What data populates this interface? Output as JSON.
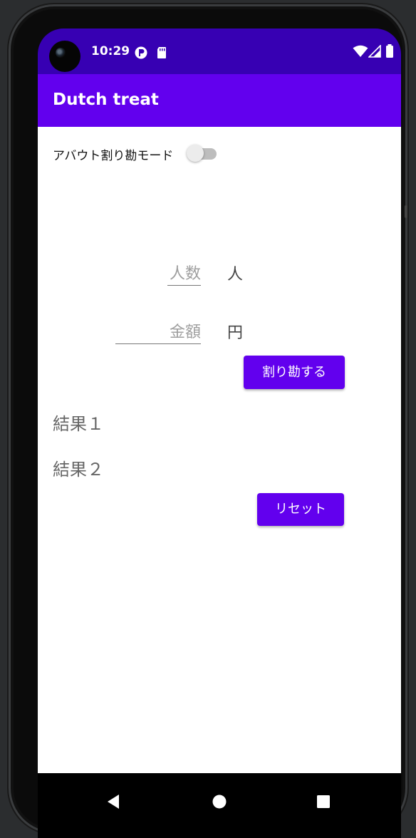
{
  "status_bar": {
    "time": "10:29",
    "icons": [
      "app-notification-icon",
      "sd-card-icon",
      "wifi-icon",
      "cell-signal-icon",
      "battery-icon"
    ]
  },
  "app_bar": {
    "title": "Dutch treat"
  },
  "about_mode": {
    "label": "アバウト割り勘モード",
    "enabled": false
  },
  "people_input": {
    "placeholder": "人数",
    "value": "",
    "unit": "人"
  },
  "amount_input": {
    "placeholder": "金額",
    "value": "",
    "unit": "円"
  },
  "split_button": {
    "label": "割り勘する"
  },
  "results": {
    "result1": "結果１",
    "result2": "結果２"
  },
  "reset_button": {
    "label": "リセット"
  },
  "nav_bar": {
    "buttons": [
      "back-icon",
      "home-icon",
      "recents-icon"
    ]
  },
  "colors": {
    "primary": "#6200ee",
    "primary_dark": "#3700b3"
  }
}
